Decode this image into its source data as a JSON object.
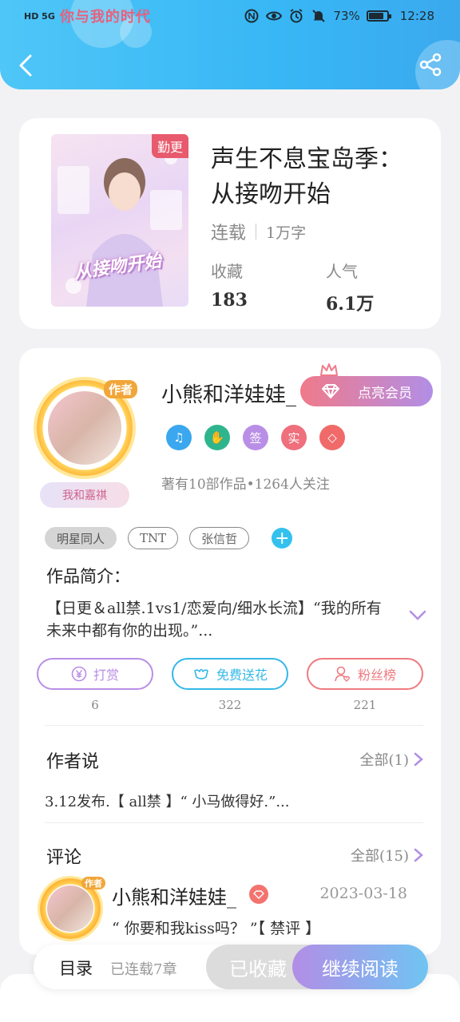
{
  "status_bar": {
    "carrier": "你与我的时代",
    "network": "HD 5G",
    "battery": "73%",
    "time": "12:28"
  },
  "book": {
    "cover_tag": "勤更",
    "cover_art_text": "从接吻开始",
    "title": "声生不息宝岛季：从接吻开始",
    "status": "连载",
    "word_count": "1万字",
    "favorites_label": "收藏",
    "favorites_value": "183",
    "popularity_label": "人气",
    "popularity_value": "6.1万"
  },
  "author": {
    "badge": "作者",
    "fan_label": "我和嘉祺",
    "name": "小熊和洋娃娃_",
    "vip_button": "点亮会员",
    "badges": [
      {
        "icon": "music-note-icon",
        "text": "♫",
        "color": "#3aa7ee"
      },
      {
        "icon": "handshake-icon",
        "text": "✋",
        "color": "#2fb58d"
      },
      {
        "icon": "sign-icon",
        "text": "签",
        "color": "#b98ee6"
      },
      {
        "icon": "real-icon",
        "text": "实",
        "color": "#ef6f7c"
      },
      {
        "icon": "diamond-icon",
        "text": "◇",
        "color": "#f06a6a"
      }
    ],
    "stats": "著有10部作品•1264人关注"
  },
  "tags": [
    "明星同人",
    "TNT",
    "张信哲"
  ],
  "intro": {
    "title": "作品简介：",
    "text": "【日更＆all禁.1vs1/恋爱向/细水长流】“我的所有未来中都有你的出现。”..."
  },
  "actions": [
    {
      "label": "打赏",
      "count": "6",
      "icon": "yen-icon",
      "color": "#b98ee6"
    },
    {
      "label": "免费送花",
      "count": "322",
      "icon": "flower-icon",
      "color": "#34b8e8"
    },
    {
      "label": "粉丝榜",
      "count": "221",
      "icon": "fan-ranking-icon",
      "color": "#ef7a80"
    }
  ],
  "author_says": {
    "title": "作者说",
    "more": "全部(1)",
    "content": "3.12发布.【 all禁 】“ 小马做得好.”..."
  },
  "comments": {
    "title": "评论",
    "more": "全部(15)",
    "first": {
      "badge": "作者",
      "name": "小熊和洋娃娃_",
      "date": "2023-03-18",
      "text": "“ 你要和我kiss吗？ ”【 禁评 】"
    }
  },
  "bottom": {
    "toc": "目录",
    "toc_sub": "已连载7章",
    "collected": "已收藏",
    "continue": "继续阅读"
  },
  "colors": {
    "header": "#3fb8f5",
    "accent_purple": "#b28ee6",
    "accent_pink": "#f07a8a"
  }
}
